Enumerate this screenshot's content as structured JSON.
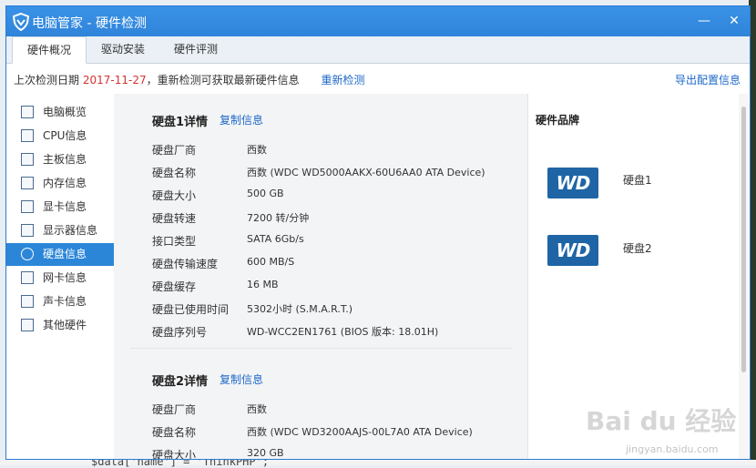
{
  "window": {
    "title": "电脑管家 - 硬件检测",
    "icons": {
      "logo": "shield-logo-icon",
      "minimize": "minimize-icon",
      "close": "close-icon"
    }
  },
  "tabs": [
    {
      "label": "硬件概况",
      "active": true
    },
    {
      "label": "驱动安装",
      "active": false
    },
    {
      "label": "硬件评测",
      "active": false
    }
  ],
  "info_bar": {
    "prefix": "上次检测日期",
    "date": "2017-11-27",
    "suffix": "，重新检测可获取最新硬件信息",
    "recheck": "重新检测",
    "export": "导出配置信息"
  },
  "sidebar": {
    "items": [
      {
        "label": "电脑概览",
        "icon": "overview-icon"
      },
      {
        "label": "CPU信息",
        "icon": "cpu-icon"
      },
      {
        "label": "主板信息",
        "icon": "motherboard-icon"
      },
      {
        "label": "内存信息",
        "icon": "memory-icon"
      },
      {
        "label": "显卡信息",
        "icon": "graphics-card-icon"
      },
      {
        "label": "显示器信息",
        "icon": "monitor-icon"
      },
      {
        "label": "硬盘信息",
        "icon": "hard-disk-icon",
        "active": true
      },
      {
        "label": "网卡信息",
        "icon": "network-card-icon"
      },
      {
        "label": "声卡信息",
        "icon": "sound-card-icon"
      },
      {
        "label": "其他硬件",
        "icon": "other-hardware-icon"
      }
    ]
  },
  "disk1": {
    "title": "硬盘1详情",
    "copy": "复制信息",
    "rows": [
      {
        "k": "硬盘厂商",
        "v": "西数"
      },
      {
        "k": "硬盘名称",
        "v": "西数 (WDC WD5000AAKX-60U6AA0 ATA Device)"
      },
      {
        "k": "硬盘大小",
        "v": "500 GB"
      },
      {
        "k": "硬盘转速",
        "v": "7200 转/分钟"
      },
      {
        "k": "接口类型",
        "v": "SATA 6Gb/s"
      },
      {
        "k": "硬盘传输速度",
        "v": "600 MB/S"
      },
      {
        "k": "硬盘缓存",
        "v": "16 MB"
      },
      {
        "k": "硬盘已使用时间",
        "v": "5302小时 (S.M.A.R.T.)"
      },
      {
        "k": "硬盘序列号",
        "v": "WD-WCC2EN1761 (BIOS 版本: 18.01H)"
      }
    ]
  },
  "disk2": {
    "title": "硬盘2详情",
    "copy": "复制信息",
    "rows": [
      {
        "k": "硬盘厂商",
        "v": "西数"
      },
      {
        "k": "硬盘名称",
        "v": "西数 (WDC WD3200AAJS-00L7A0 ATA Device)"
      },
      {
        "k": "硬盘大小",
        "v": "320 GB"
      }
    ]
  },
  "brand": {
    "title": "硬件品牌",
    "logo_text": "WD",
    "disks": [
      "硬盘1",
      "硬盘2"
    ]
  },
  "watermark": {
    "main": "Bai du 经验",
    "sub": "jingyan.baidu.com"
  },
  "background_code": "$data['name'] = 'ThinkPHP';",
  "colors": {
    "titlebar": "#2f84da",
    "accent": "#2b86d8",
    "link": "#1d68c7",
    "date": "#d7322f",
    "wd_badge": "#1f65a6"
  }
}
